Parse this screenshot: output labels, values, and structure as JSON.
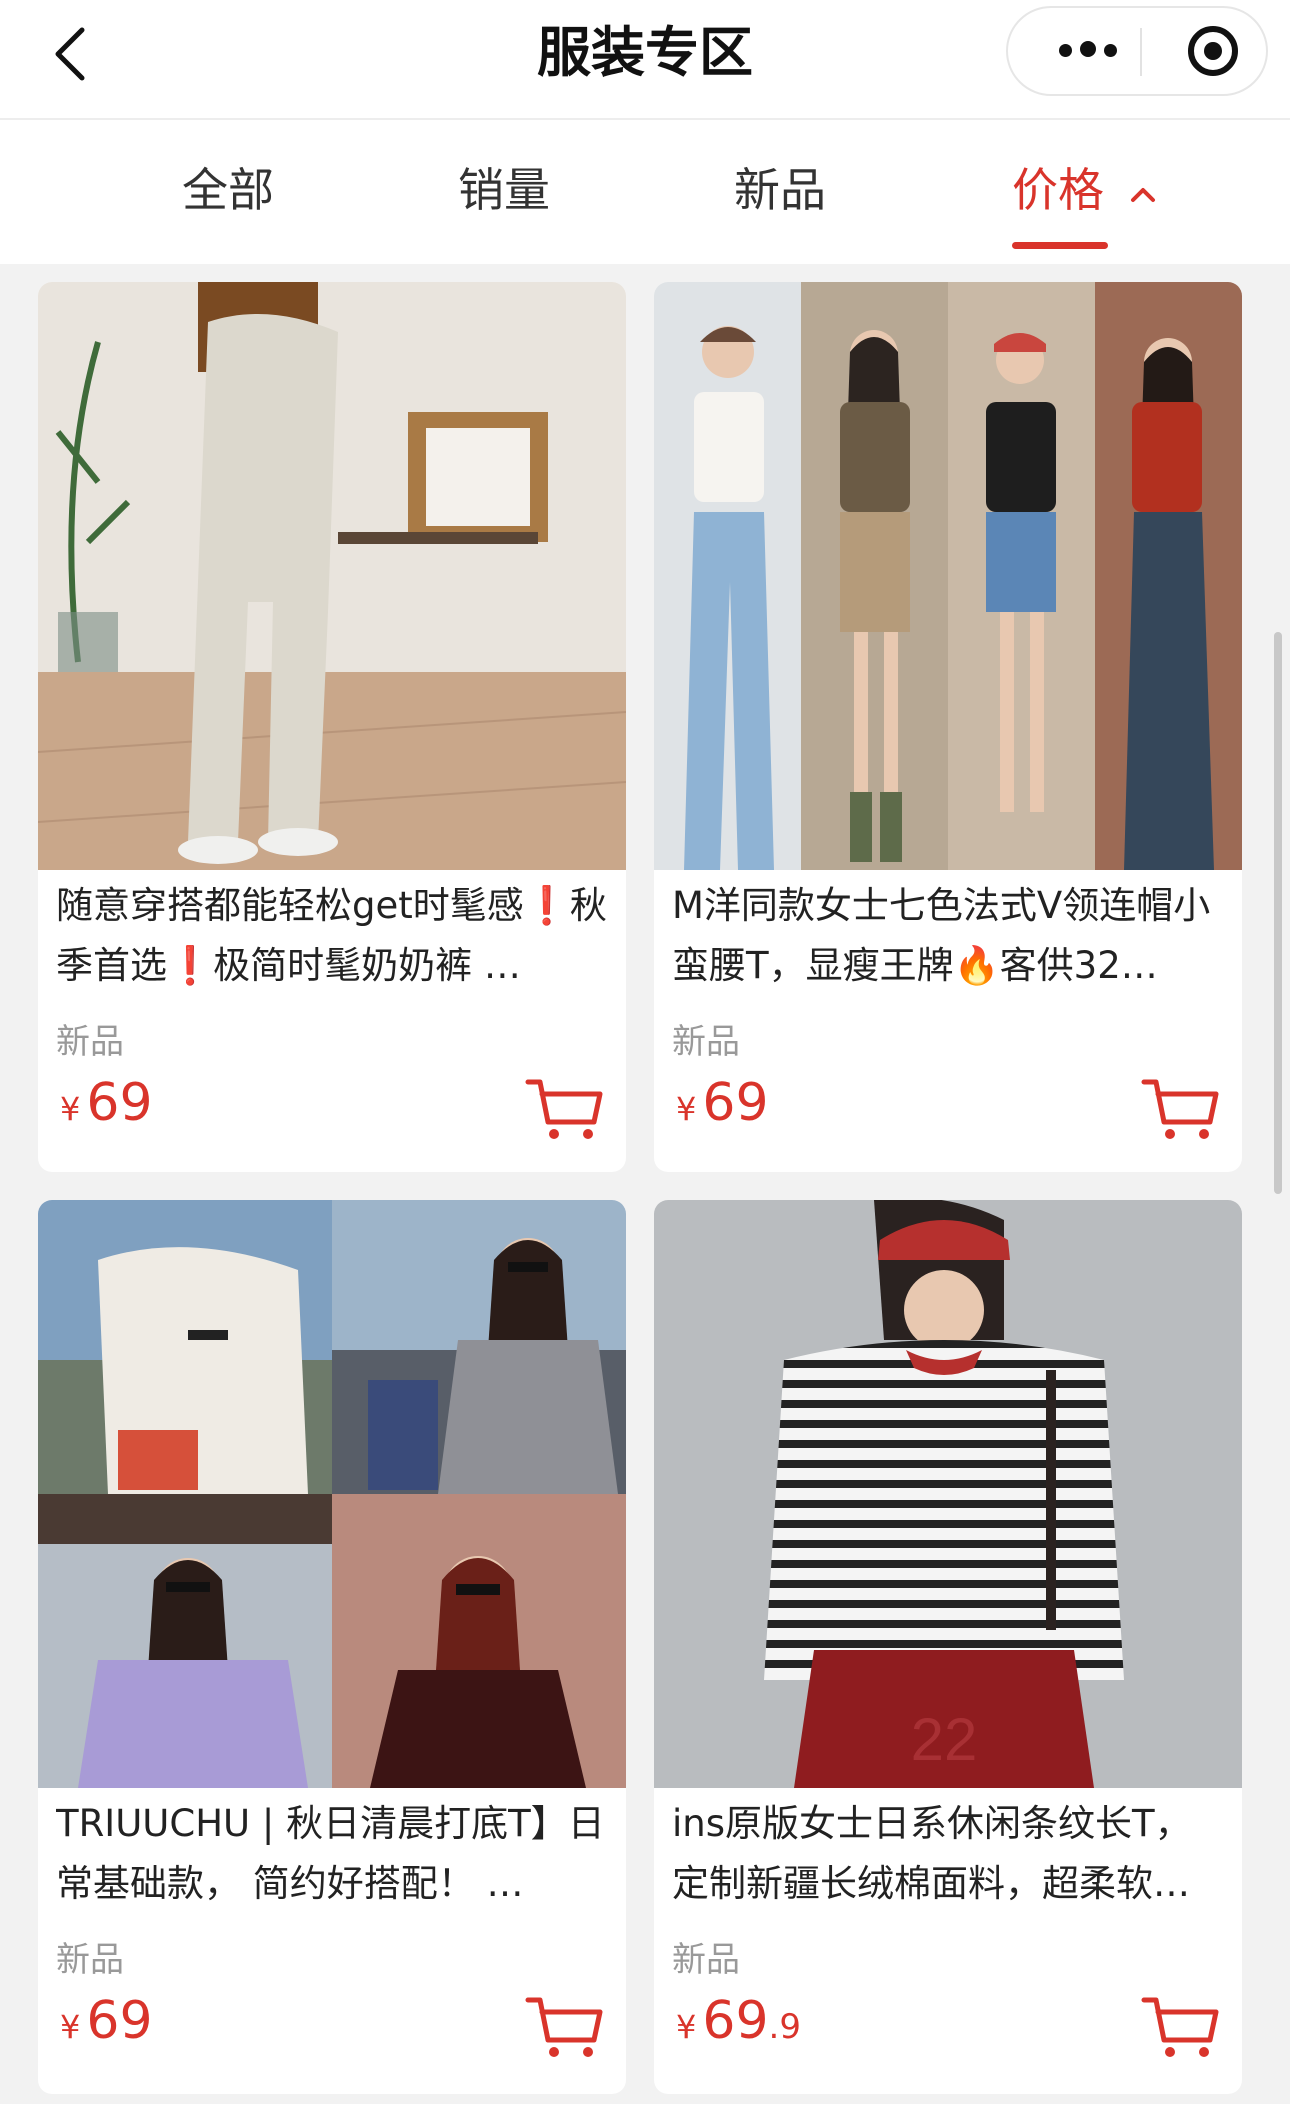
{
  "header": {
    "title": "服装专区"
  },
  "tabs": [
    {
      "label": "全部"
    },
    {
      "label": "销量"
    },
    {
      "label": "新品"
    },
    {
      "label": "价格"
    }
  ],
  "products": [
    {
      "desc": "随意穿搭都能轻松get时髦感❗秋季首选❗极简时髦奶奶裤 …",
      "tag": "新品",
      "currency": "¥",
      "price_int": "69",
      "price_dec": ""
    },
    {
      "desc": "M洋同款女士七色法式V领连帽小蛮腰T，显瘦王牌🔥客供32…",
      "tag": "新品",
      "currency": "¥",
      "price_int": "69",
      "price_dec": ""
    },
    {
      "desc": "TRIUUCHU | 秋日清晨打底T】日常基础款， 简约好搭配！ …",
      "tag": "新品",
      "currency": "¥",
      "price_int": "69",
      "price_dec": ""
    },
    {
      "desc": "ins原版女士日系休闲条纹长T，定制新疆长绒棉面料，超柔软…",
      "tag": "新品",
      "currency": "¥",
      "price_int": "69",
      "price_dec": ".9"
    }
  ],
  "colors": {
    "accent": "#d9342b",
    "page_bg": "#f2f2f2"
  },
  "icons": [
    "back-arrow-icon",
    "more-dots-icon",
    "target-circle-icon",
    "chevron-up-icon",
    "cart-icon"
  ]
}
